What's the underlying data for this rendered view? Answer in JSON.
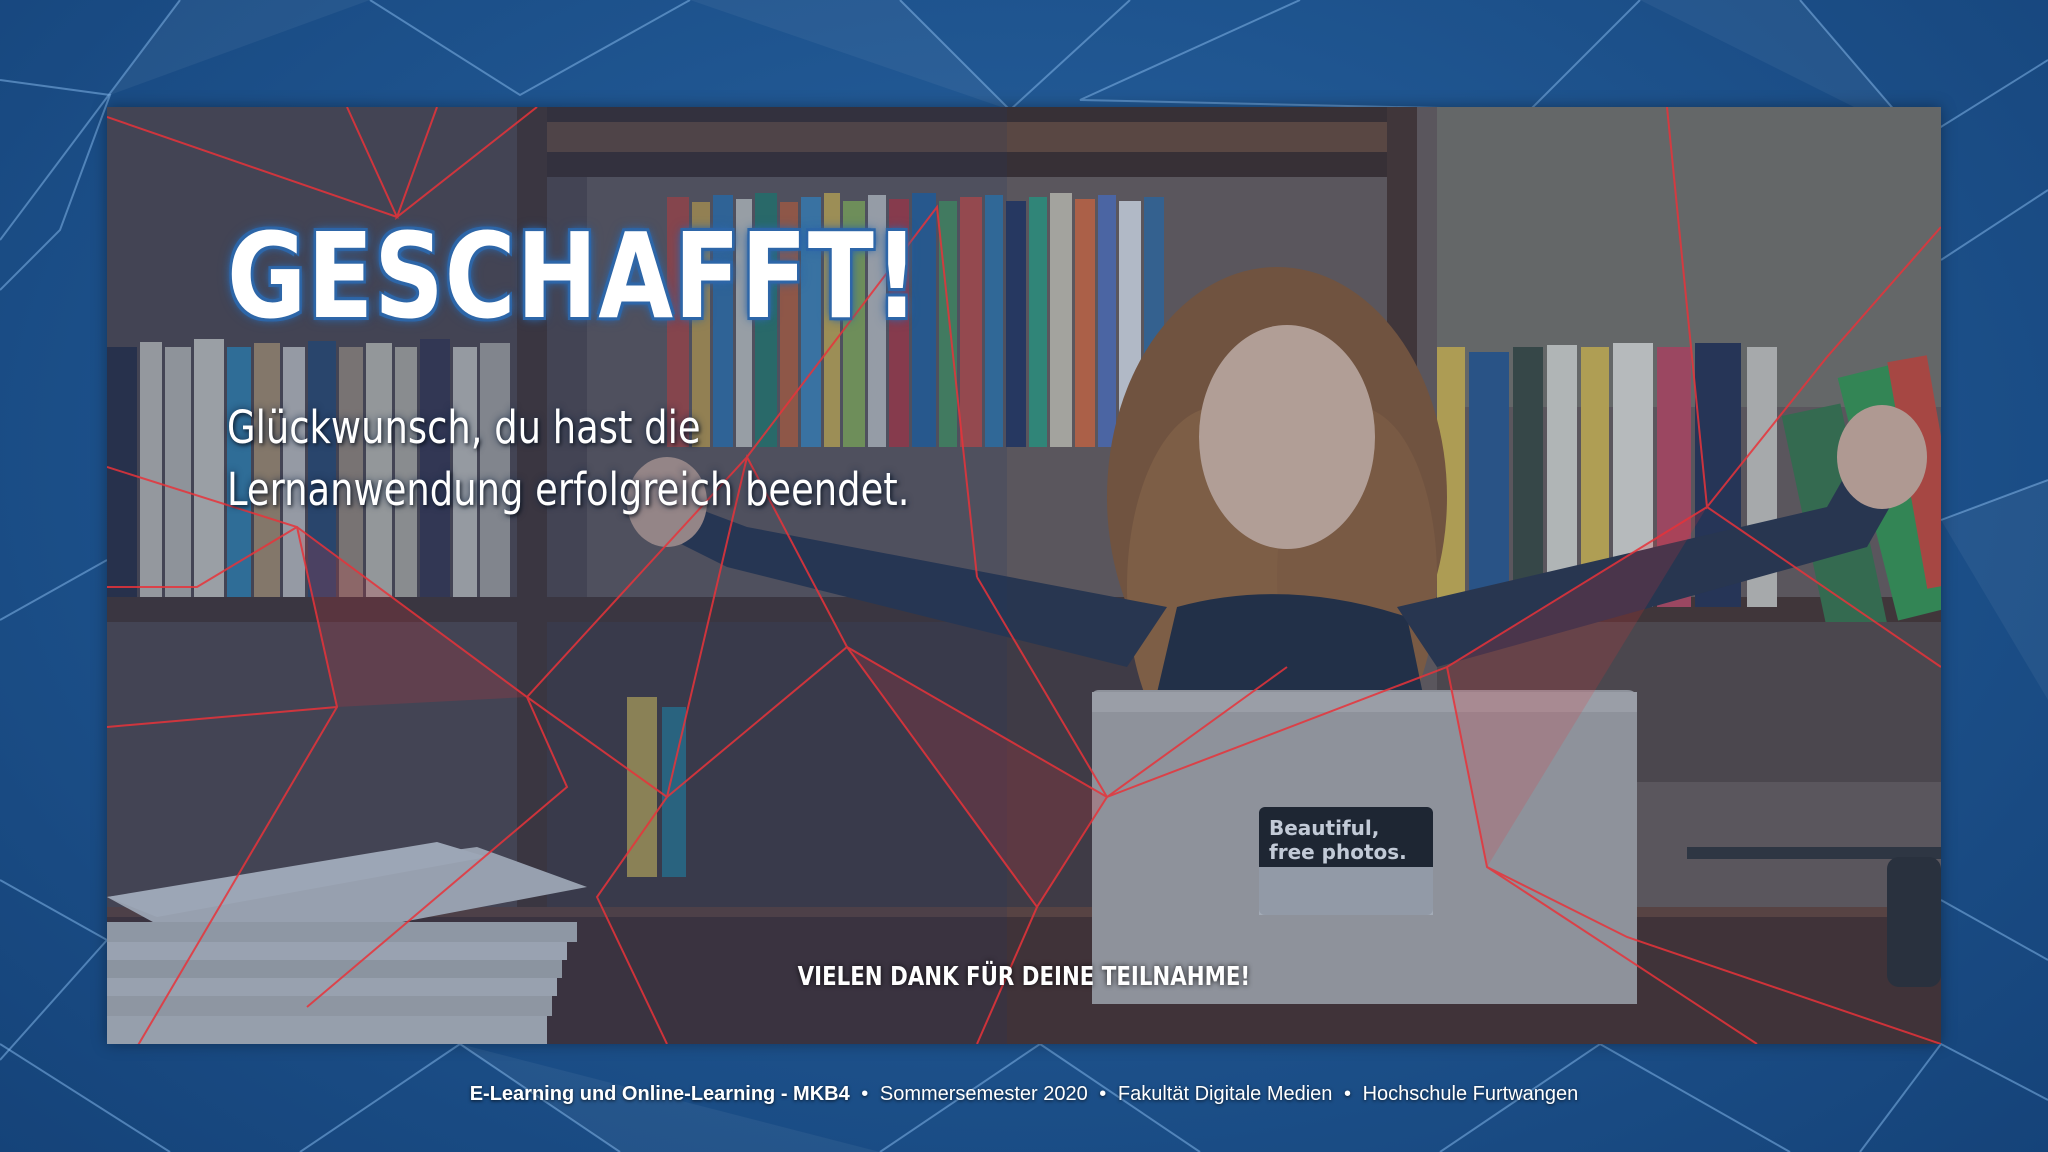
{
  "slide": {
    "title": "GESCHAFFT!",
    "subtitle_line1": "Glückwunsch, du hast die",
    "subtitle_line2": "Lernanwendung erfolgreich beendet.",
    "thanks": "VIELEN DANK FÜR DEINE TEILNAHME!",
    "laptop_sticker_line1": "Beautiful,",
    "laptop_sticker_line2": "free photos."
  },
  "footer": {
    "course": "E-Learning und Online-Learning - MKB4",
    "semester": "Sommersemester 2020",
    "faculty": "Fakultät Digitale Medien",
    "university": "Hochschule Furtwangen",
    "separator": "•"
  },
  "colors": {
    "background_blue": "#1f5590",
    "title_outline": "#2f67a8",
    "network_lines": "#e8333a",
    "text": "#ffffff"
  }
}
